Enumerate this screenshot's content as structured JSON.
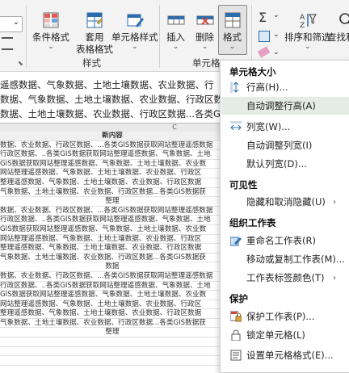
{
  "ribbon": {
    "cells_group_label": "单元格",
    "styles_group_label": "样式",
    "sigma_label": "Σ",
    "buttons": {
      "conditional_format": "条件格式",
      "table_format_line1": "套用",
      "table_format_line2": "表格格式",
      "cell_styles": "单元格样式",
      "insert": "插入",
      "delete": "删除",
      "format": "格式",
      "sort_filter": "排序和筛选",
      "find_select": "查找和选"
    },
    "chevron": "⌄",
    "launcher": "⬊"
  },
  "sheet": {
    "long_line_1": "遥感数据、气象数据、土地土壤数据、农业数据、行",
    "long_line_2": "数据、气象数据、土地土壤数据、农业数据、行政区数",
    "long_line_3": "数据、土地土壤数据、农业数据、行政区数据...各类G",
    "right_snippet_1": "站",
    "right_snippet_2": "数",
    "column_letter": "C",
    "header_cell": "新内容",
    "rows": [
      "数据、农业数据、行政区数据、...各类GIS数据获取网站整理遥感数据",
      "行政区数据、..各类GIS数据获取网站整理遥感数据、气象数据、土地",
      "GIS数据获取网站整理遥感数据、气象数据、土地土壤数据、农业数",
      "网站整理遥感数据、气象数据、土地土壤数据、农业数据、行政区",
      "整理遥感数据、气象数据、土地土壤数据、农业数据、行政区数据",
      "气象数据、土地土壤数据、农业数据、行政区数据...各类GIS数据获",
      "整理",
      "数据、农业数据、行政区数据、...各类GIS数据获取网站整理遥感数据",
      "行政区数据、..各类GIS数据获取网站整理遥感数据、气象数据、土地",
      "GIS数据获取网站整理遥感数据、气象数据、土地土壤数据、农业数",
      "网站整理遥感数据、气象数据、土地土壤数据、农业数据、行政区",
      "整理遥感数据、气象数据、土地土壤数据、农业数据、行政区数据",
      "气象数据、土地土壤数据、农业数据、行政区数据...各类GIS数据获",
      "数据",
      "数据、农业数据、行政区数据、...各类GIS数据获取网站整理遥感数据",
      "行政区数据、..各类GIS数据获取网站整理遥感数据、气象数据、土地",
      "GIS数据获取网站整理遥感数据、气象数据、土地土壤数据、农业数",
      "网站整理遥感数据、气象数据、土地土壤数据、农业数据、行政区",
      "整理遥感数据、气象数据、土地土壤数据、农业数据、行政区数据",
      "气象数据、土地土壤数据、农业数据、行政区数据...各类GIS数据获",
      "整理",
      "",
      "",
      "",
      "",
      ""
    ],
    "right_col": [
      "遥",
      "遥",
      "遥",
      "遥"
    ]
  },
  "menu": {
    "section_size": "单元格大小",
    "row_height": "行高(H)...",
    "autofit_row": "自动调整行高(A)",
    "column_width": "列宽(W)...",
    "autofit_column": "自动调整列宽(I)",
    "default_width": "默认列宽(D)...",
    "section_visibility": "可见性",
    "hide_unhide": "隐藏和取消隐藏(U)",
    "section_organize": "组织工作表",
    "rename_sheet": "重命名工作表(R)",
    "move_copy": "移动或复制工作表(M)...",
    "tab_color": "工作表标签颜色(T)",
    "section_protect": "保护",
    "protect_sheet": "保护工作表(P)...",
    "lock_cell": "锁定单元格(L)",
    "format_cells": "设置单元格格式(E)...",
    "submenu_arrow": "›"
  },
  "colors": {
    "accent_blue": "#2b6cb0",
    "red_icon": "#d04a3c",
    "highlight": "#e5ebe5"
  }
}
